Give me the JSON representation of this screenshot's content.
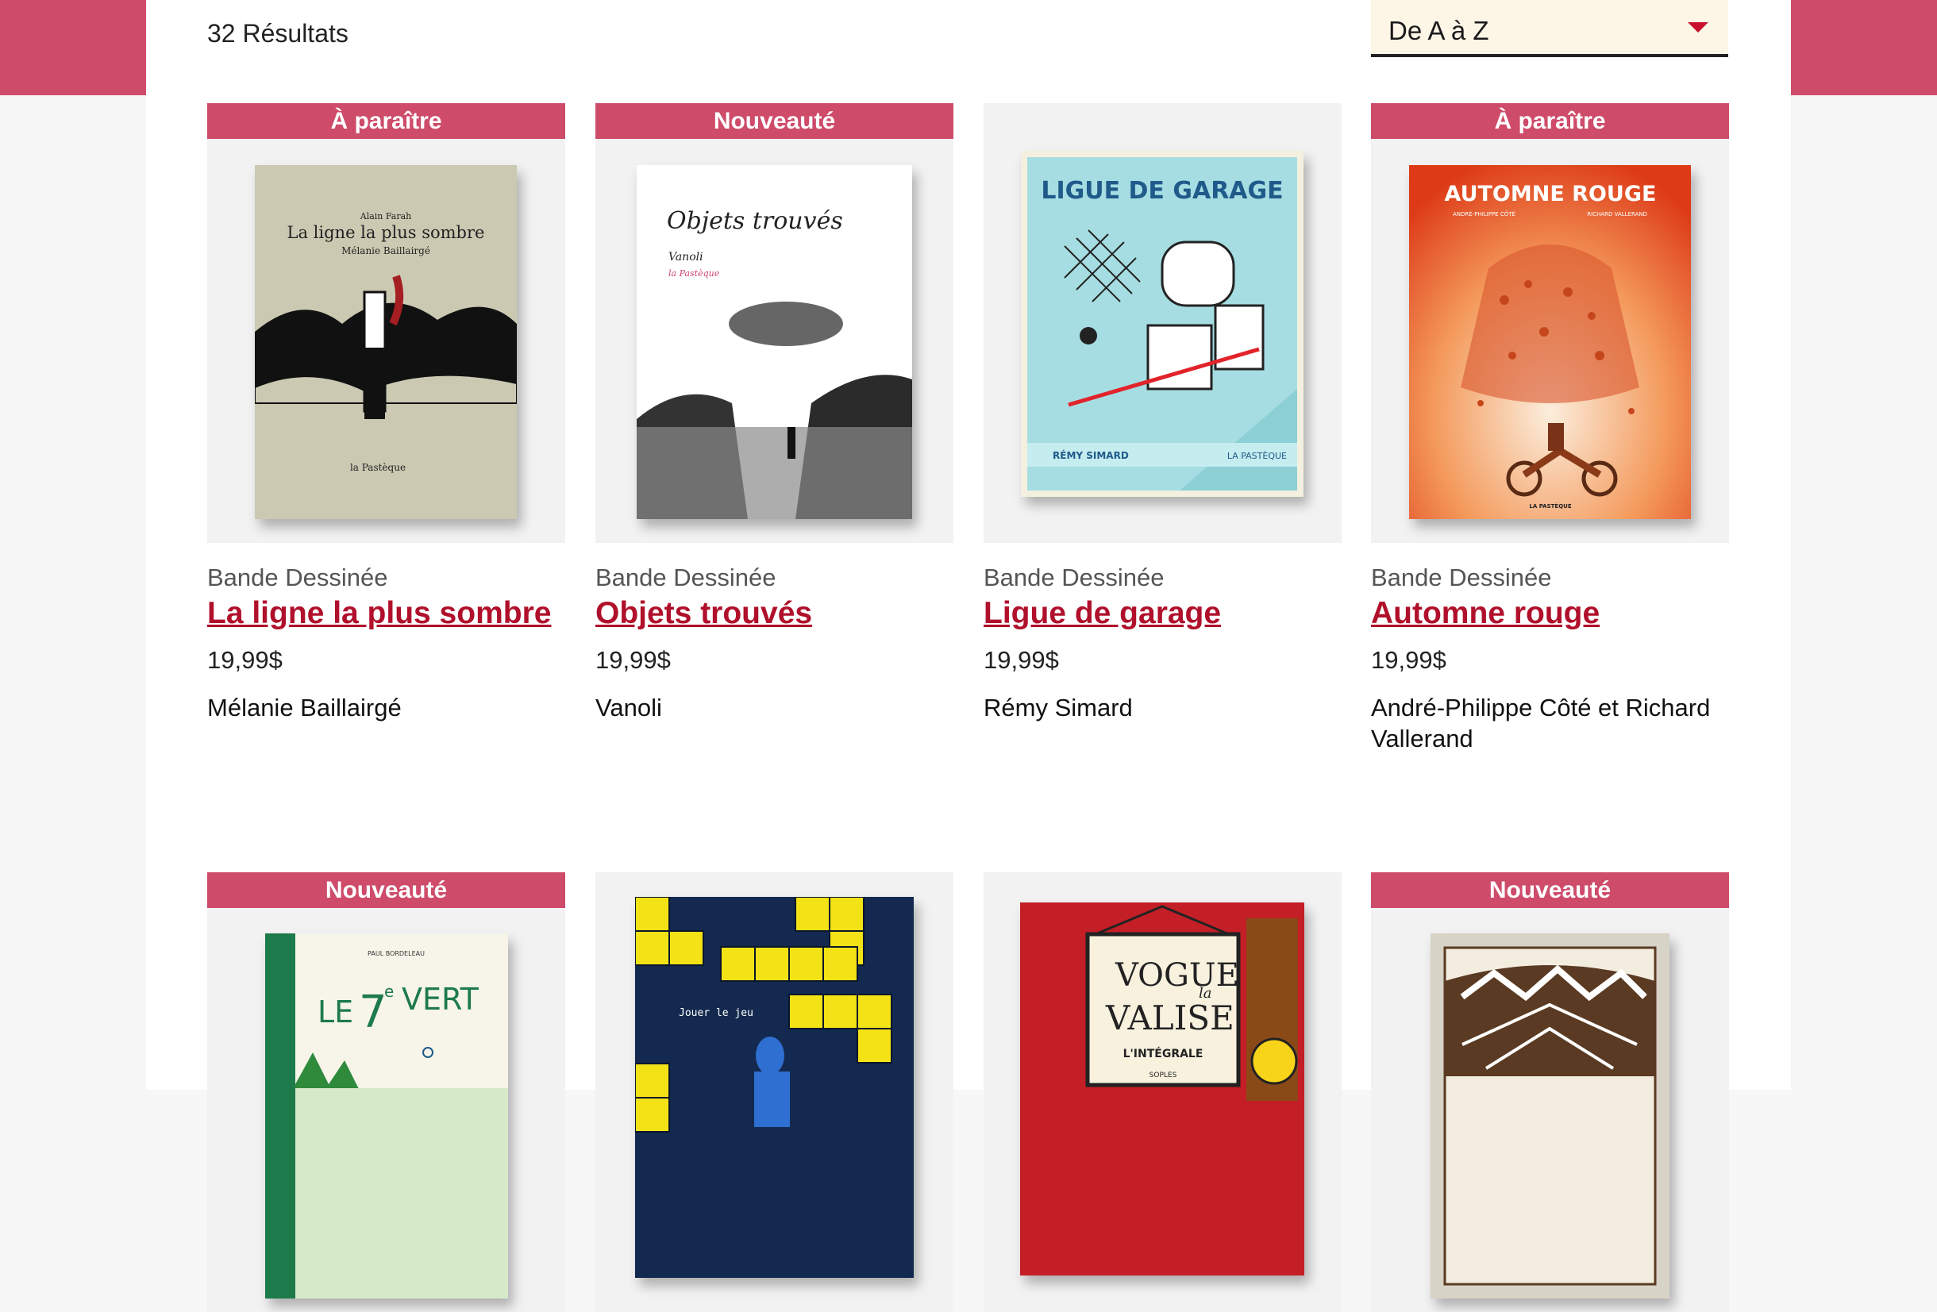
{
  "results": {
    "count_label": "32 Résultats"
  },
  "sort": {
    "selected": "De A à Z"
  },
  "colors": {
    "accent": "#ce4b6a",
    "title_link": "#b0102b",
    "select_bg": "#fdf5e6"
  },
  "products": [
    {
      "badge": "À paraître",
      "category": "Bande Dessinée",
      "title": "La ligne la plus sombre",
      "price": "19,99$",
      "author": "Mélanie Baillairgé",
      "cover": {
        "bg": "#cbc9b2",
        "text_color": "#222",
        "top_small": "Alain Farah",
        "title": "La ligne la plus sombre",
        "subtitle": "Mélanie Baillairgé",
        "publisher": "la Pastèque"
      }
    },
    {
      "badge": "Nouveauté",
      "category": "Bande Dessinée",
      "title": "Objets trouvés",
      "price": "19,99$",
      "author": "Vanoli",
      "cover": {
        "bg": "#ffffff",
        "text_color": "#222",
        "title": "Objets trouvés",
        "subtitle": "Vanoli",
        "publisher": "la Pastèque"
      }
    },
    {
      "badge": "",
      "category": "Bande Dessinée",
      "title": "Ligue de garage",
      "price": "19,99$",
      "author": "Rémy Simard",
      "cover": {
        "bg": "#a6dde2",
        "text_color": "#1f5a8a",
        "title": "LIGUE DE GARAGE",
        "author_line": "RÉMY SIMARD",
        "publisher": "LA PASTÈQUE"
      }
    },
    {
      "badge": "À paraître",
      "category": "Bande Dessinée",
      "title": "Automne rouge",
      "price": "19,99$",
      "author": "André-Philippe Côté et Richard Vallerand",
      "cover": {
        "bg": "#e44a1d",
        "text_color": "#ffffff",
        "title": "AUTOMNE ROUGE",
        "left_name": "ANDRÉ-PHILIPPE CÔTÉ",
        "right_name": "RICHARD VALLERAND",
        "publisher": "LA PASTÈQUE"
      }
    },
    {
      "badge": "Nouveauté",
      "category": "",
      "title": "",
      "price": "",
      "author": "",
      "cover": {
        "bg": "#f7f5e9",
        "text_color": "#1d7a4b",
        "top_small": "PAUL BORDELEAU",
        "title_a": "LE",
        "title_b": "7",
        "title_sup": "e",
        "title_c": "VERT"
      }
    },
    {
      "badge": "",
      "category": "",
      "title": "",
      "price": "",
      "author": "",
      "cover": {
        "bg": "#13294f",
        "text_color": "#ffffff",
        "side_text": "Jouer le jeu"
      }
    },
    {
      "badge": "",
      "category": "",
      "title": "",
      "price": "",
      "author": "",
      "cover": {
        "bg": "#c41e26",
        "text_color": "#222",
        "title_a": "VOGUE",
        "title_b": "la",
        "title_c": "VALISE",
        "subtitle": "L'INTÉGRALE",
        "publisher": "SOPLES"
      }
    },
    {
      "badge": "Nouveauté",
      "category": "",
      "title": "",
      "price": "",
      "author": "",
      "cover": {
        "bg": "#d8d3c7",
        "text_color": "#5a3a22"
      }
    }
  ]
}
